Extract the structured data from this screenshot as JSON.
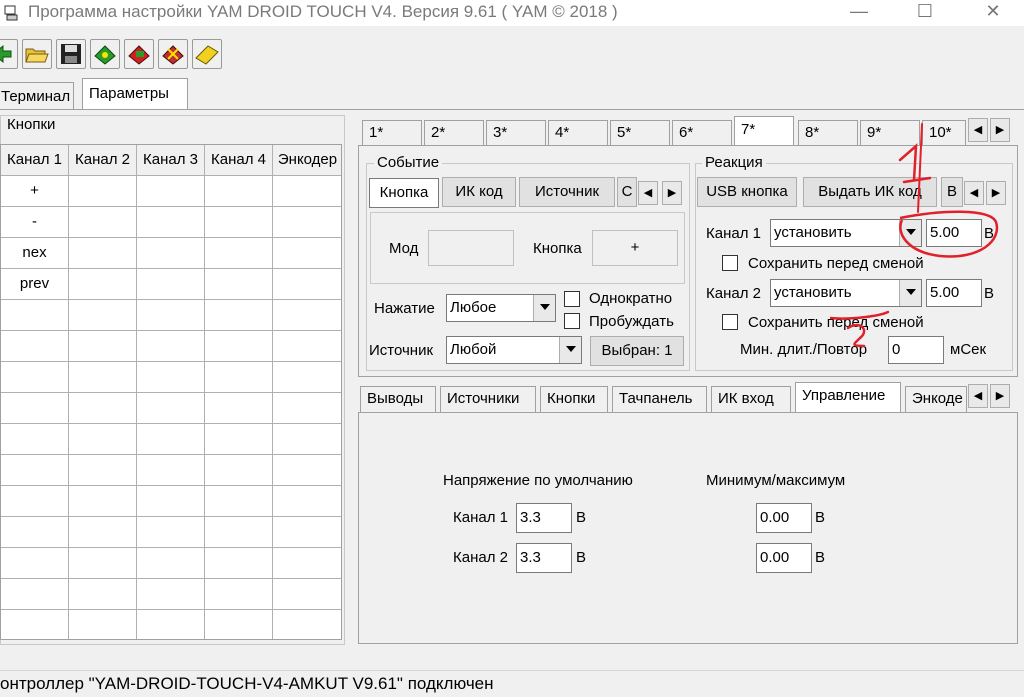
{
  "window": {
    "title": "Программа настройки YAM DROID TOUCH V4. Версия 9.61 ( YAM © 2018 )",
    "minimize": "—",
    "maximize": "☐",
    "close": "✕"
  },
  "toolbar": {
    "icons": [
      "connect-icon",
      "open-folder-icon",
      "save-icon",
      "read-device-icon",
      "write-device-icon",
      "reset-device-icon",
      "chip-icon"
    ]
  },
  "main_tabs": [
    {
      "label": "Терминал"
    },
    {
      "label": "Параметры"
    }
  ],
  "buttons_panel": {
    "title": "Кнопки",
    "columns": [
      "Канал 1",
      "Канал 2",
      "Канал 3",
      "Канал 4",
      "Энкодер"
    ],
    "rows": [
      [
        "+"
      ],
      [
        "-"
      ],
      [
        "nex"
      ],
      [
        "prev"
      ],
      [
        ""
      ],
      [
        ""
      ],
      [
        ""
      ],
      [
        ""
      ],
      [
        ""
      ],
      [
        ""
      ],
      [
        ""
      ],
      [
        ""
      ],
      [
        ""
      ],
      [
        ""
      ],
      [
        ""
      ]
    ]
  },
  "number_tabs": [
    {
      "label": "1*"
    },
    {
      "label": "2*"
    },
    {
      "label": "3*"
    },
    {
      "label": "4*"
    },
    {
      "label": "5*"
    },
    {
      "label": "6*"
    },
    {
      "label": "7*"
    },
    {
      "label": "8*"
    },
    {
      "label": "9*"
    },
    {
      "label": "10*"
    }
  ],
  "event": {
    "title": "Событие",
    "tabs": [
      "Кнопка",
      "ИК код",
      "Источник",
      "С"
    ],
    "mod_label": "Мод",
    "mod_value": "",
    "button_label": "Кнопка",
    "button_value": "+",
    "press_label": "Нажатие",
    "press_value": "Любое",
    "once_label": "Однократно",
    "wake_label": "Пробуждать",
    "source_label": "Источник",
    "source_value": "Любой",
    "selected_button": "Выбран: 1"
  },
  "reaction": {
    "title": "Реакция",
    "tabs": [
      "USB кнопка",
      "Выдать ИК код",
      "В"
    ],
    "channel1_label": "Канал 1",
    "channel1_action": "установить",
    "channel1_value": "5.00",
    "channel1_unit": "В",
    "save1_label": "Сохранить перед сменой",
    "channel2_label": "Канал 2",
    "channel2_action": "установить",
    "channel2_value": "5.00",
    "channel2_unit": "В",
    "save2_label": "Сохранить перед сменой",
    "min_label": "Мин. длит./Повтор",
    "min_value": "0",
    "min_unit": "мСек"
  },
  "annotations": {
    "mark1": "1",
    "mark2": "2"
  },
  "bottom_tabs": [
    {
      "label": "Выводы"
    },
    {
      "label": "Источники"
    },
    {
      "label": "Кнопки"
    },
    {
      "label": "Тачпанель"
    },
    {
      "label": "ИК вход"
    },
    {
      "label": "Управление"
    },
    {
      "label": "Энкоде"
    }
  ],
  "control": {
    "default_voltage_label": "Напряжение по умолчанию",
    "minmax_label": "Минимум/максимум",
    "ch1_label": "Канал 1",
    "ch1_value": "3.3",
    "ch1_unit": "В",
    "ch1_minmax": "0.00",
    "ch1_minmax_unit": "В",
    "ch2_label": "Канал 2",
    "ch2_value": "3.3",
    "ch2_unit": "В",
    "ch2_minmax": "0.00",
    "ch2_minmax_unit": "В"
  },
  "status": {
    "text": "онтроллер \"YAM-DROID-TOUCH-V4-AMKUT V9.61\" подключен"
  },
  "colors": {
    "annotation_red": "#e0202a",
    "window_bg": "#f0f0f0"
  }
}
